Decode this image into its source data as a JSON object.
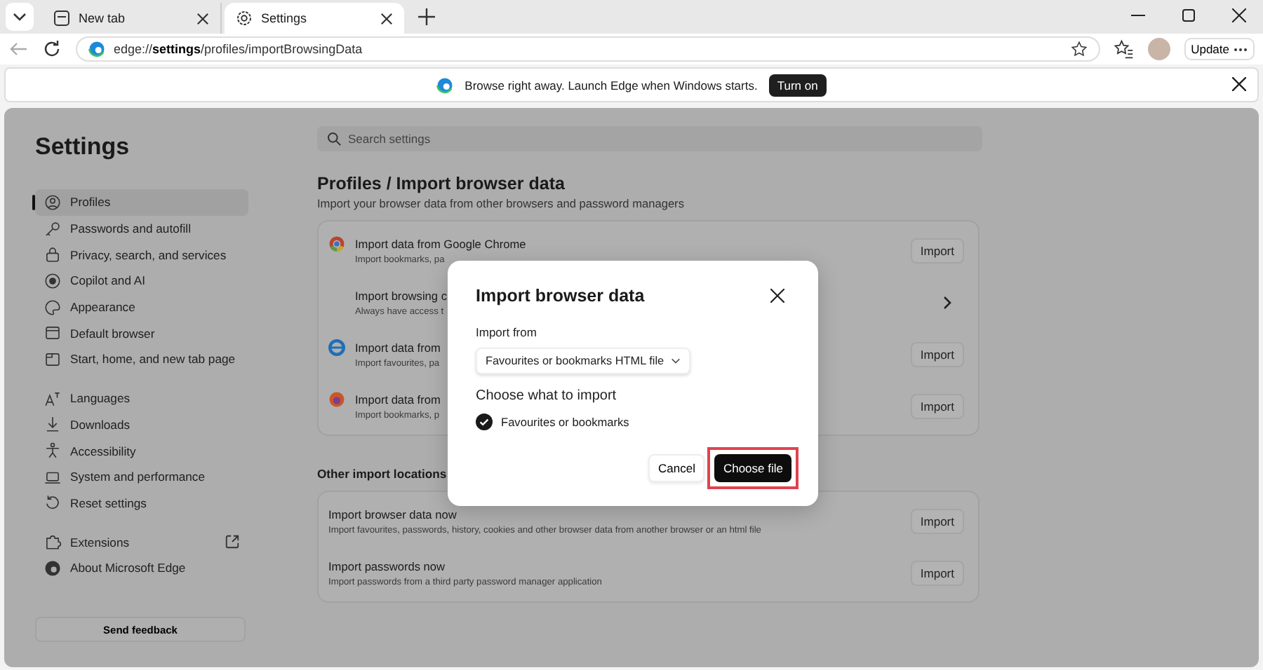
{
  "tabs": [
    {
      "title": "New tab",
      "selected": false
    },
    {
      "title": "Settings",
      "selected": true
    }
  ],
  "address_bar": {
    "url": "edge://**settings**/profiles/importBrowsingData"
  },
  "update_button": "Update",
  "infobar": {
    "message": "Browse right away. Launch Edge when Windows starts.",
    "button": "Turn on"
  },
  "sidebar": {
    "title": "Settings",
    "groups": [
      [
        {
          "label": "Profiles",
          "selected": true
        },
        {
          "label": "Passwords and autofill",
          "selected": false
        },
        {
          "label": "Privacy, search, and services",
          "selected": false
        },
        {
          "label": "Copilot and AI",
          "selected": false
        },
        {
          "label": "Appearance",
          "selected": false
        },
        {
          "label": "Default browser",
          "selected": false
        },
        {
          "label": "Start, home, and new tab page",
          "selected": false
        }
      ],
      [
        {
          "label": "Languages",
          "selected": false
        },
        {
          "label": "Downloads",
          "selected": false
        },
        {
          "label": "Accessibility",
          "selected": false
        },
        {
          "label": "System and performance",
          "selected": false
        },
        {
          "label": "Reset settings",
          "selected": false
        }
      ],
      [
        {
          "label": "Extensions",
          "selected": false,
          "external": true
        },
        {
          "label": "About Microsoft Edge",
          "selected": false,
          "external": false
        }
      ]
    ],
    "feedback_button": "Send feedback"
  },
  "search": {
    "placeholder": "Search settings"
  },
  "page": {
    "breadcrumb": "Profiles / Import browser data",
    "subtitle": "Import your browser data from other browsers and password managers",
    "rows": [
      {
        "kind": "import",
        "title": "Import data from Google Chrome",
        "description": "Import bookmarks, pa",
        "action": "Import"
      },
      {
        "kind": "link",
        "title": "Import browsing c",
        "description": "Always have access t"
      },
      {
        "kind": "import",
        "title": "Import data from",
        "description": "Import favourites, pa",
        "action": "Import"
      },
      {
        "kind": "import",
        "title": "Import data from",
        "description": "Import bookmarks, p",
        "action": "Import"
      }
    ],
    "other_heading": "Other import locations",
    "other_rows": [
      {
        "kind": "import",
        "title": "Import browser data now",
        "description": "Import favourites, passwords, history, cookies and other browser data from another browser or an html file",
        "action": "Import"
      },
      {
        "kind": "import",
        "title": "Import passwords now",
        "description": "Import passwords from a third party password manager application",
        "action": "Import"
      }
    ]
  },
  "dialog": {
    "title": "Import browser data",
    "import_from_label": "Import from",
    "import_from_value": "Favourites or bookmarks HTML file",
    "choose_label": "Choose what to import",
    "options": [
      {
        "label": "Favourites or bookmarks",
        "checked": true
      }
    ],
    "cancel": "Cancel",
    "confirm": "Choose file",
    "confirm_highlighted": true
  }
}
